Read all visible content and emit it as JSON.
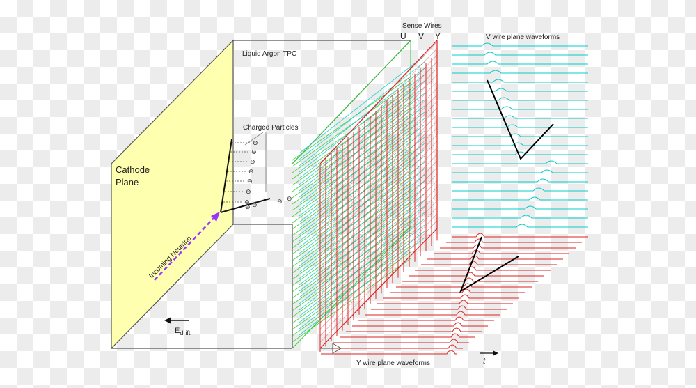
{
  "labels": {
    "cathode_line1": "Cathode",
    "cathode_line2": "Plane",
    "tpc": "Liquid Argon TPC",
    "charged_particles": "Charged Particles",
    "incoming_neutrino": "Incoming Neutrino",
    "e_drift_main": "E",
    "e_drift_sub": "drift",
    "sense_wires": "Sense Wires",
    "u": "U",
    "v": "V",
    "y": "Y",
    "v_waveforms": "V wire plane waveforms",
    "y_waveforms": "Y wire plane waveforms",
    "t_axis": "t",
    "electron_symbol": "⊖"
  },
  "colors": {
    "cathode_fill": "#ffffb0",
    "u_wires": "#33cc33",
    "v_wires": "#00cccc",
    "y_wires": "#dd2222",
    "neutrino": "#9933ff",
    "track": "#111111"
  }
}
